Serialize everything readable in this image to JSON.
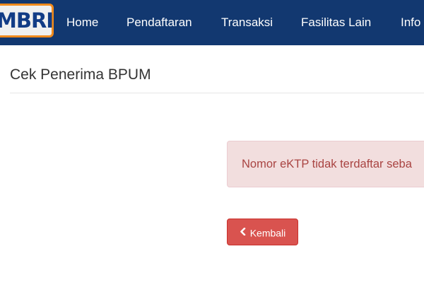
{
  "brand": {
    "logo_text": "MBRI",
    "colors": {
      "navbar": "#123870",
      "logo_border": "#f08a1c",
      "logo_text": "#123c86"
    }
  },
  "nav": {
    "items": [
      {
        "label": "Home"
      },
      {
        "label": "Pendaftaran"
      },
      {
        "label": "Transaksi"
      },
      {
        "label": "Fasilitas Lain"
      },
      {
        "label": "Info"
      }
    ]
  },
  "page": {
    "title": "Cek Penerima BPUM"
  },
  "alert": {
    "message": "Nomor eKTP tidak terdaftar seba",
    "colors": {
      "background": "#f2dede",
      "text": "#a94442"
    }
  },
  "back_button": {
    "label": "Kembali",
    "icon": "chevron-left-icon",
    "color": "#d9534f"
  }
}
